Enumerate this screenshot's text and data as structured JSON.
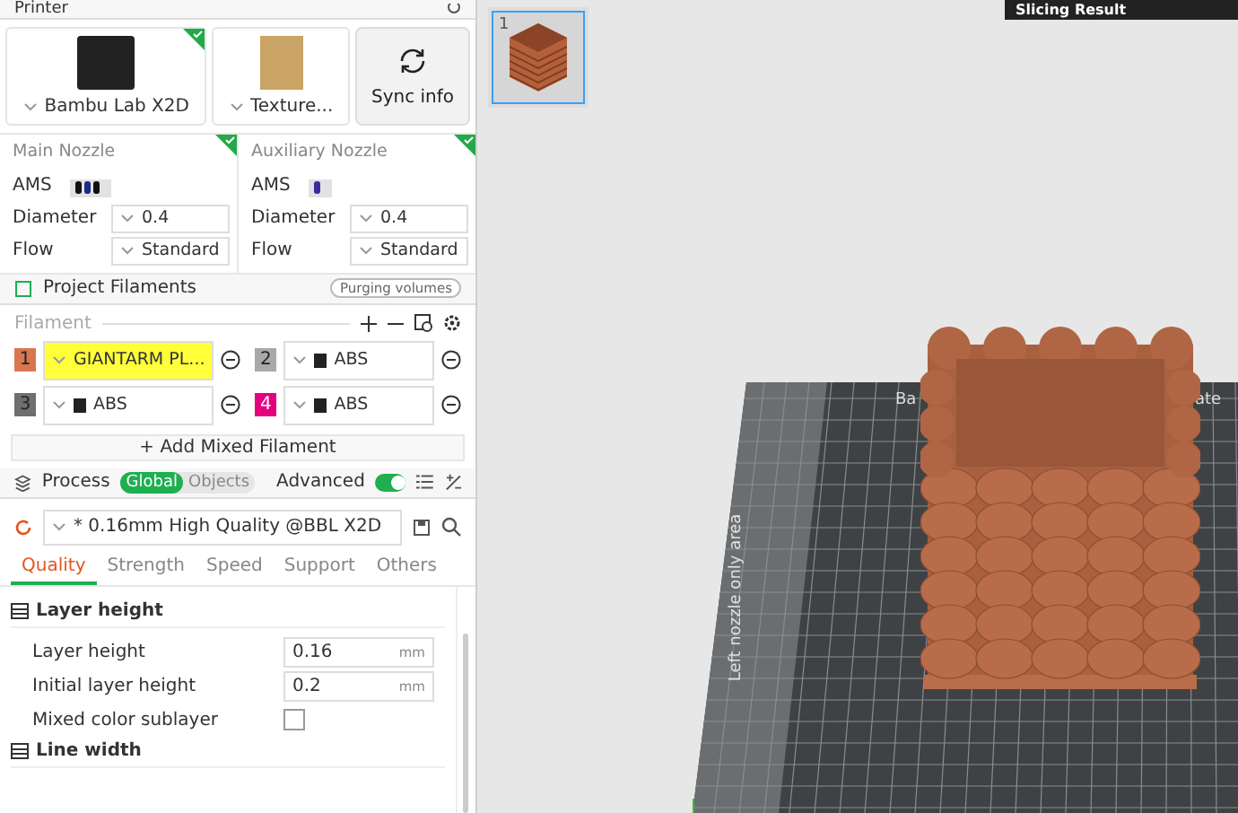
{
  "printer": {
    "title": "Printer",
    "model": "Bambu Lab X2D",
    "plate": "Texture...",
    "sync_button": "Sync info"
  },
  "nozzles": [
    {
      "title": "Main Nozzle",
      "ams_label": "AMS",
      "diameter_label": "Diameter",
      "diameter": "0.4",
      "flow_label": "Flow",
      "flow": "Standard"
    },
    {
      "title": "Auxiliary Nozzle",
      "ams_label": "AMS",
      "diameter_label": "Diameter",
      "diameter": "0.4",
      "flow_label": "Flow",
      "flow": "Standard"
    }
  ],
  "filaments": {
    "title": "Project Filaments",
    "purge_button": "Purging volumes",
    "label": "Filament",
    "slots": [
      {
        "number": "1",
        "name": "GIANTARM PL...",
        "color": "#d9764f",
        "highlighted": true
      },
      {
        "number": "2",
        "name": "ABS",
        "color": "#a9a9a9",
        "highlighted": false
      },
      {
        "number": "3",
        "name": "ABS",
        "color": "#6f6f6f",
        "highlighted": false
      },
      {
        "number": "4",
        "name": "ABS",
        "color": "#e5007e",
        "highlighted": false
      }
    ],
    "add_button": "+ Add Mixed Filament"
  },
  "process": {
    "title": "Process",
    "scope_tabs": [
      {
        "label": "Global",
        "selected": true
      },
      {
        "label": "Objects",
        "selected": false
      }
    ],
    "advanced_label": "Advanced",
    "advanced_on": true,
    "preset": "* 0.16mm High Quality @BBL X2D",
    "tabs": [
      {
        "label": "Quality",
        "selected": true
      },
      {
        "label": "Strength",
        "selected": false
      },
      {
        "label": "Speed",
        "selected": false
      },
      {
        "label": "Support",
        "selected": false
      },
      {
        "label": "Others",
        "selected": false
      }
    ],
    "sections": [
      {
        "title": "Layer height",
        "rows": [
          {
            "kind": "number",
            "label": "Layer height",
            "value": "0.16",
            "unit": "mm"
          },
          {
            "kind": "number",
            "label": "Initial layer height",
            "value": "0.2",
            "unit": "mm"
          },
          {
            "kind": "checkbox",
            "label": "Mixed color sublayer",
            "checked": false
          }
        ]
      },
      {
        "title": "Line width"
      }
    ]
  },
  "viewport": {
    "plate_number": "1",
    "plate_selected": true,
    "slicing_result": "Slicing Result",
    "nozzle_area_label": "Left nozzle only area",
    "bed_label_parts": [
      "Ba",
      "ate"
    ]
  }
}
